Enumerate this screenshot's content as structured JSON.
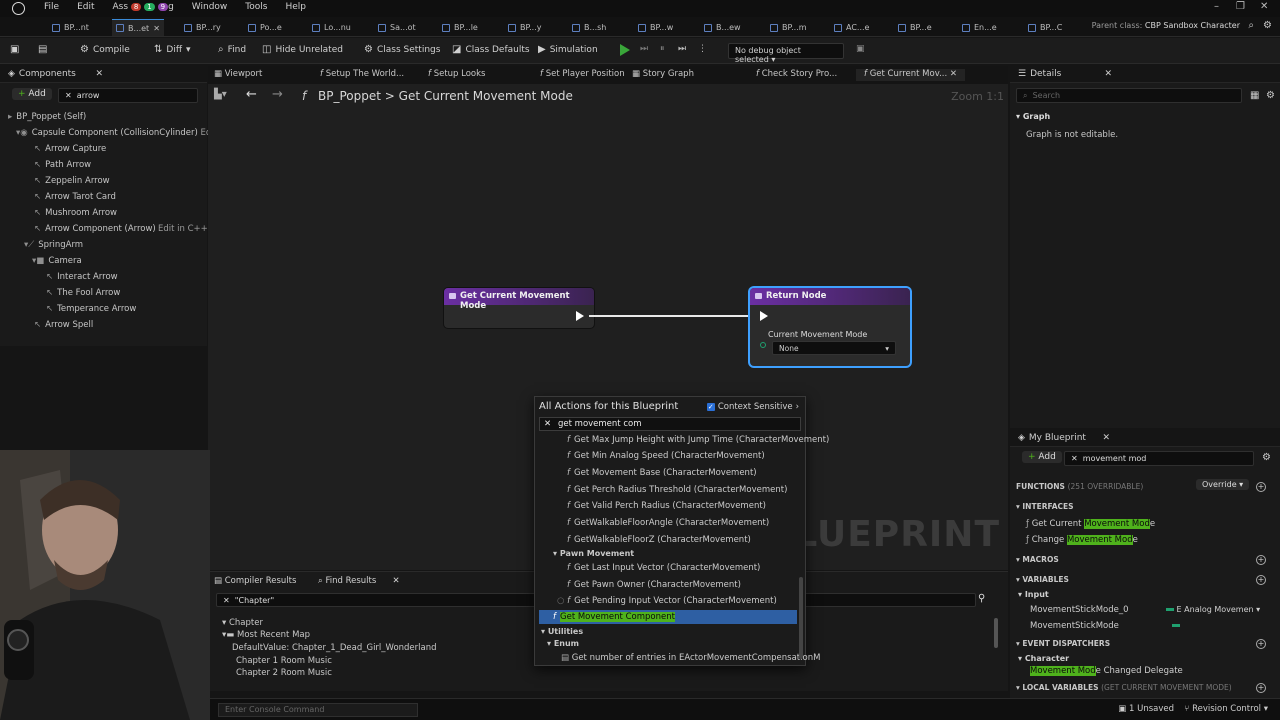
{
  "titlebar": {
    "menu": [
      "File",
      "Edit",
      "Ass",
      "g",
      "Window",
      "Tools",
      "Help"
    ],
    "badges": [
      "8",
      "1",
      "9"
    ]
  },
  "doc_tabs": [
    "BP...nt",
    "B...et",
    "BP...ry",
    "Po...e",
    "Lo...nu",
    "Sa...ot",
    "BP...le",
    "BP...y",
    "B...sh",
    "BP...w",
    "B...ew",
    "BP...m",
    "AC...e",
    "BP...e",
    "En...e",
    "BP...C"
  ],
  "parent_class": {
    "label": "Parent class:",
    "value": "CBP Sandbox Character"
  },
  "toolbar": {
    "compile": "Compile",
    "diff": "Diff",
    "find": "Find",
    "hide_unrelated": "Hide Unrelated",
    "class_settings": "Class Settings",
    "class_defaults": "Class Defaults",
    "simulation": "Simulation",
    "debug_object": "No debug object selected"
  },
  "components": {
    "title": "Components",
    "add": "Add",
    "search": "arrow",
    "items": [
      "BP_Poppet (Self)",
      "Capsule Component (CollisionCylinder)",
      "Arrow Capture",
      "Path Arrow",
      "Zeppelin Arrow",
      "Arrow Tarot Card",
      "Mushroom Arrow",
      "Arrow Component (Arrow)",
      "SpringArm",
      "Camera",
      "Interact Arrow",
      "The Fool Arrow",
      "Temperance Arrow",
      "Arrow Spell"
    ],
    "edit_tag": "Ed",
    "edit_cpp": "Edit in C++"
  },
  "graph_tabs": [
    "Viewport",
    "Setup The World...",
    "Setup Looks",
    "Set Player Position",
    "Story Graph",
    "Check Story Pro...",
    "Get Current Mov..."
  ],
  "breadcrumb": {
    "root": "BP_Poppet",
    "sep": ">",
    "current": "Get Current Movement Mode"
  },
  "zoom": "Zoom 1:1",
  "watermark": "BLUEPRINT",
  "nodes": {
    "entry": {
      "title": "Get Current Movement Mode"
    },
    "return": {
      "title": "Return Node",
      "pin_label": "Current Movement Mode",
      "pin_value": "None"
    }
  },
  "action_menu": {
    "title": "All Actions for this Blueprint",
    "context_sensitive": "Context Sensitive",
    "search": "get movement com",
    "items": [
      "Get Max Jump Height with Jump Time (CharacterMovement)",
      "Get Min Analog Speed (CharacterMovement)",
      "Get Movement Base (CharacterMovement)",
      "Get Perch Radius Threshold (CharacterMovement)",
      "Get Valid Perch Radius (CharacterMovement)",
      "GetWalkableFloorAngle (CharacterMovement)",
      "GetWalkableFloorZ (CharacterMovement)"
    ],
    "category_pawn": "Pawn Movement",
    "pawn_items": [
      "Get Last Input Vector (CharacterMovement)",
      "Get Pawn Owner (CharacterMovement)",
      "Get Pending Input Vector (CharacterMovement)"
    ],
    "selected": "Get Movement Component",
    "category_utilities": "Utilities",
    "category_enum": "Enum",
    "enum_item": "Get number of entries in EActorMovementCompensationM"
  },
  "bottom": {
    "compiler_results": "Compiler Results",
    "find_results": "Find Results",
    "search": "\"Chapter\"",
    "results": [
      "Chapter",
      "Most Recent Map",
      "DefaultValue: Chapter_1_Dead_Girl_Wonderland",
      "Chapter 1 Room Music",
      "Chapter 2 Room Music"
    ]
  },
  "status": {
    "console_placeholder": "Enter Console Command",
    "unsaved": "1 Unsaved",
    "revision": "Revision Control"
  },
  "details": {
    "title": "Details",
    "search_placeholder": "Search",
    "section": "Graph",
    "message": "Graph is not editable."
  },
  "my_blueprint": {
    "title": "My Blueprint",
    "add": "Add",
    "search": "movement mod",
    "functions": "FUNCTIONS",
    "functions_count": "(251 OVERRIDABLE)",
    "override": "Override",
    "interfaces": "INTERFACES",
    "interface_items": [
      {
        "prefix": "Get Current ",
        "hl": "Movement Mod",
        "suffix": "e"
      },
      {
        "prefix": "Change ",
        "hl": "Movement Mod",
        "suffix": "e"
      }
    ],
    "macros": "MACROS",
    "variables": "VARIABLES",
    "var_group": "Input",
    "var_items": [
      {
        "name": "MovementStickMode_0",
        "type": "E Analog Movemen"
      },
      {
        "name": "MovementStickMode",
        "type": ""
      }
    ],
    "event_dispatchers": "EVENT DISPATCHERS",
    "dispatcher_group": "Character",
    "dispatcher_item": {
      "hl": "Movement Mod",
      "suffix": "e Changed Delegate"
    },
    "local_variables": "LOCAL VARIABLES",
    "local_variables_scope": "(GET CURRENT MOVEMENT MODE)"
  },
  "colors": {
    "function_node_header": "#6b2fa3",
    "return_node_header": "#6b2fa3",
    "selection_outline": "#3ea0ff",
    "highlight": "#4fb21c",
    "play_green": "#3aa63a"
  }
}
